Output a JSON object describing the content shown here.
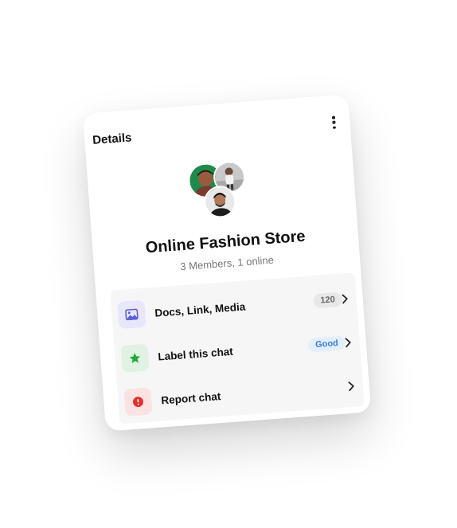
{
  "card": {
    "title": "Details"
  },
  "group": {
    "name": "Online Fashion Store",
    "subtitle": "3 Members, 1 online"
  },
  "options": [
    {
      "label": "Docs, Link, Media",
      "badge": "120",
      "icon": "image-icon"
    },
    {
      "label": "Label this chat",
      "badge": "Good",
      "icon": "star-icon"
    },
    {
      "label": "Report chat",
      "badge": "",
      "icon": "alert-icon"
    }
  ],
  "colors": {
    "media_accent": "#5b5fd6",
    "label_accent": "#22a93a",
    "report_accent": "#e0312b",
    "good_badge_text": "#3a7ce0"
  }
}
